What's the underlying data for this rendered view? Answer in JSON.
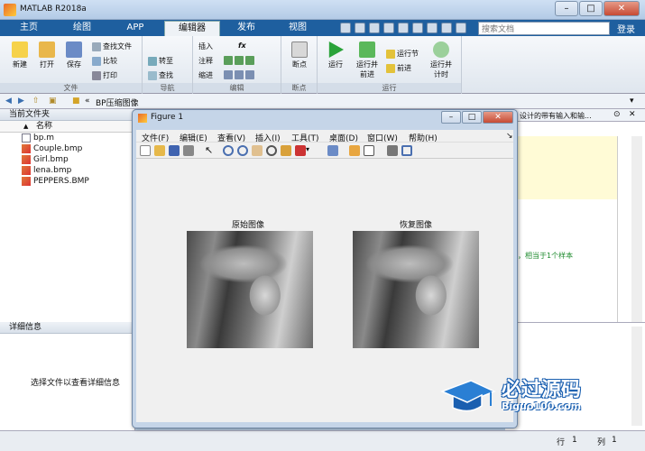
{
  "window": {
    "title": "MATLAB R2018a"
  },
  "tabs": [
    {
      "label": "主页"
    },
    {
      "label": "绘图"
    },
    {
      "label": "APP"
    },
    {
      "label": "编辑器"
    },
    {
      "label": "发布"
    },
    {
      "label": "视图"
    }
  ],
  "search": {
    "placeholder": "搜索文档"
  },
  "login_label": "登录",
  "toolstrip": {
    "file": {
      "group": "文件",
      "new": "新建",
      "open": "打开",
      "save": "保存",
      "find_files": "查找文件",
      "compare": "比较",
      "print": "打印"
    },
    "nav": {
      "group": "导航",
      "goto": "转至",
      "find": "查找"
    },
    "edit": {
      "group": "编辑",
      "insert": "插入",
      "comment": "注释",
      "indent": "缩进",
      "fx": "fx"
    },
    "breakpoints": {
      "group": "断点",
      "label": "断点"
    },
    "run": {
      "group": "运行",
      "run": "运行",
      "run_advance": "运行并\n前进",
      "run_section": "运行节",
      "advance": "前进",
      "run_time": "运行并\n计时"
    }
  },
  "path": {
    "sep": "«",
    "folder": "BP压缩图像"
  },
  "current_folder": {
    "header": "当前文件夹",
    "col_name": "名称",
    "sort_indicator": "▲",
    "files": [
      {
        "name": "bp.m",
        "type": "m"
      },
      {
        "name": "Couple.bmp",
        "type": "bmp"
      },
      {
        "name": "Girl.bmp",
        "type": "bmp"
      },
      {
        "name": "lena.bmp",
        "type": "bmp"
      },
      {
        "name": "PEPPERS.BMP",
        "type": "bmp"
      }
    ]
  },
  "details": {
    "header": "详细信息",
    "message": "选择文件以查看详细信息"
  },
  "editor_snippets": {
    "top": "设计的带有输入和输...",
    "mid": "，相当于1个样本"
  },
  "status": {
    "row_label": "行",
    "row": "1",
    "col_label": "列",
    "col": "1"
  },
  "figure": {
    "title": "Figure 1",
    "menu": [
      "文件(F)",
      "编辑(E)",
      "查看(V)",
      "插入(I)",
      "工具(T)",
      "桌面(D)",
      "窗口(W)",
      "帮助(H)"
    ],
    "axes": [
      {
        "title": "原始图像"
      },
      {
        "title": "恢复图像"
      }
    ]
  },
  "watermark": {
    "brand": "必过源码",
    "domain": "Biguo100.com"
  },
  "colors": {
    "tab_bar": "#1e5f9f",
    "toolstrip": "#eef2f6",
    "run_green": "#2aa33a"
  }
}
